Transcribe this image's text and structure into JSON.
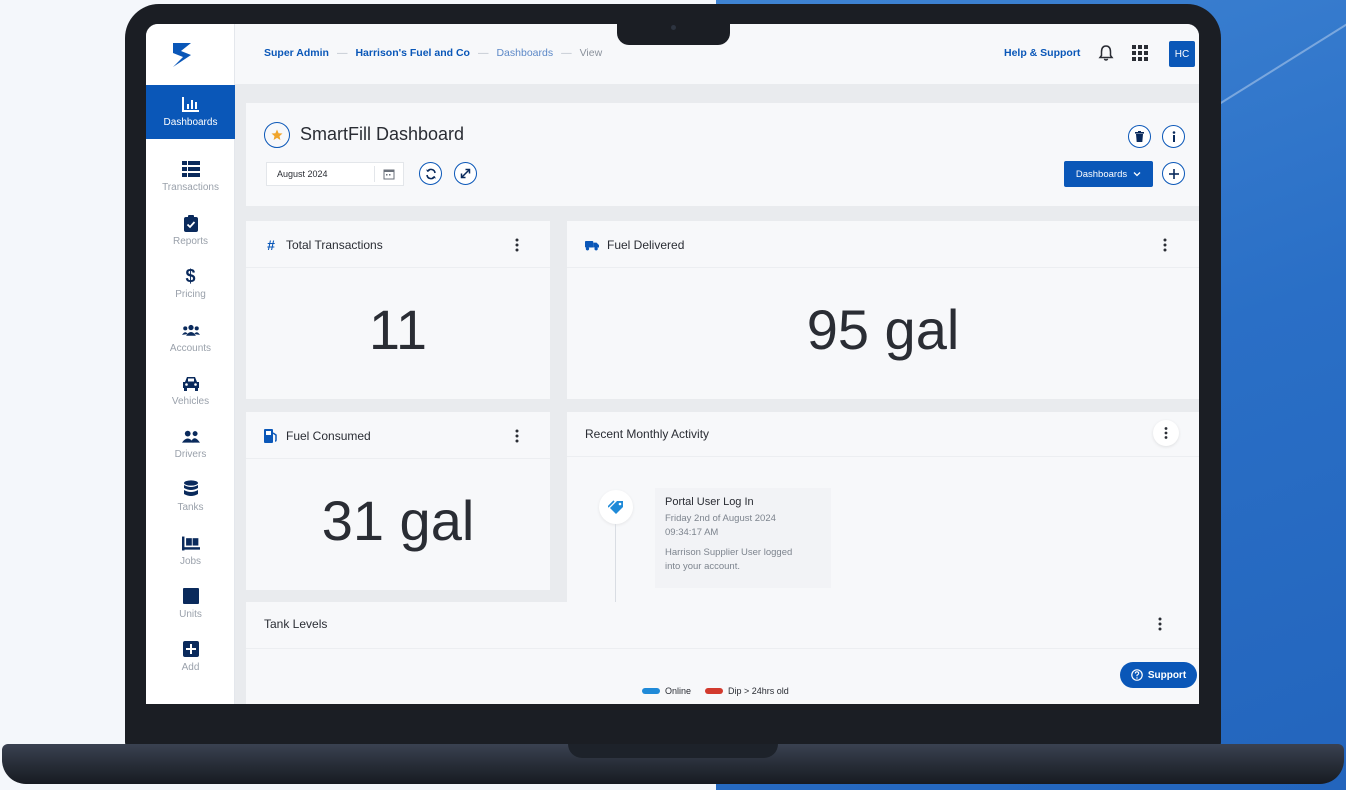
{
  "breadcrumb": {
    "items": [
      "Super Admin",
      "Harrison's Fuel and Co",
      "Dashboards",
      "View"
    ],
    "separator": "—"
  },
  "topbar": {
    "help_label": "Help & Support",
    "avatar_initials": "HC"
  },
  "sidebar": {
    "items": [
      {
        "label": "Dashboards",
        "icon": "bar-chart-icon",
        "active": true
      },
      {
        "label": "Transactions",
        "icon": "table-icon"
      },
      {
        "label": "Reports",
        "icon": "clipboard-check-icon"
      },
      {
        "label": "Pricing",
        "icon": "dollar-icon"
      },
      {
        "label": "Accounts",
        "icon": "users-icon"
      },
      {
        "label": "Vehicles",
        "icon": "car-icon"
      },
      {
        "label": "Drivers",
        "icon": "user-group-icon"
      },
      {
        "label": "Tanks",
        "icon": "database-icon"
      },
      {
        "label": "Jobs",
        "icon": "pallet-icon"
      },
      {
        "label": "Units",
        "icon": "square-icon"
      },
      {
        "label": "Add",
        "icon": "plus-square-icon"
      }
    ]
  },
  "dashboard": {
    "title": "SmartFill Dashboard",
    "date_value": "August 2024",
    "dropdown_label": "Dashboards"
  },
  "cards": {
    "total_transactions": {
      "title": "Total Transactions",
      "value": "11"
    },
    "fuel_delivered": {
      "title": "Fuel Delivered",
      "value": "95 gal"
    },
    "fuel_consumed": {
      "title": "Fuel Consumed",
      "value": "31 gal"
    },
    "recent_activity": {
      "title": "Recent Monthly Activity",
      "entry": {
        "title": "Portal User Log In",
        "date": "Friday 2nd of August 2024",
        "time": "09:34:17 AM",
        "desc_line1": "Harrison Supplier User logged",
        "desc_line2": "into your account."
      }
    },
    "tank_levels": {
      "title": "Tank Levels",
      "legend": [
        {
          "label": "Online",
          "color": "#1f8ad8"
        },
        {
          "label": "Dip > 24hrs old",
          "color": "#d23a2e"
        }
      ]
    }
  },
  "support_label": "Support",
  "colors": {
    "brand": "#0a57b8",
    "accent_star": "#f0a52b"
  }
}
